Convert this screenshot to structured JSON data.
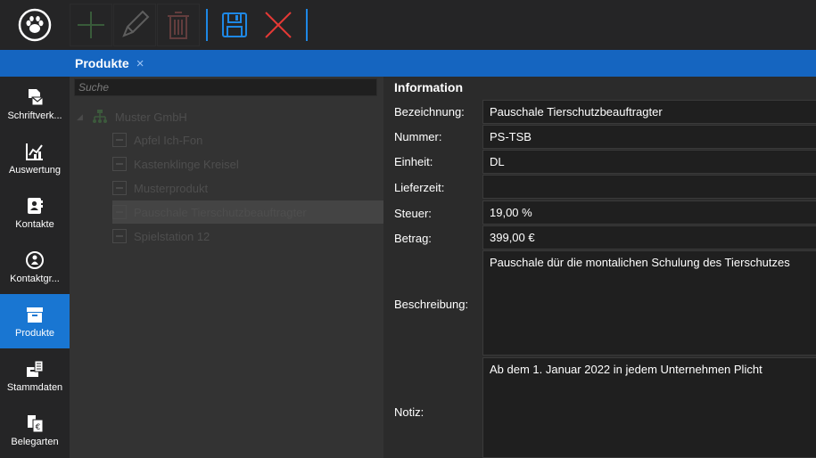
{
  "toolbar": {
    "buttons": [
      {
        "name": "add",
        "icon": "plus-icon"
      },
      {
        "name": "edit",
        "icon": "pencil-icon"
      },
      {
        "name": "delete",
        "icon": "trash-icon"
      },
      {
        "name": "save",
        "icon": "floppy-disk-icon"
      },
      {
        "name": "cancel",
        "icon": "x-icon"
      }
    ],
    "accent": "#1e88e5",
    "cancel_color": "#e53935"
  },
  "tab": {
    "label": "Produkte",
    "close": "×"
  },
  "sidebar": {
    "items": [
      {
        "label": "Schriftverk...",
        "icon": "letter-icon",
        "active": false
      },
      {
        "label": "Auswertung",
        "icon": "chart-icon",
        "active": false
      },
      {
        "label": "Kontakte",
        "icon": "contact-card-icon",
        "active": false
      },
      {
        "label": "Kontaktgr...",
        "icon": "contact-group-icon",
        "active": false
      },
      {
        "label": "Produkte",
        "icon": "product-box-icon",
        "active": true
      },
      {
        "label": "Stammdaten",
        "icon": "master-data-icon",
        "active": false
      },
      {
        "label": "Belegarten",
        "icon": "document-euro-icon",
        "active": false
      }
    ]
  },
  "search": {
    "placeholder": "Suche"
  },
  "tree": {
    "root": "Muster GmbH",
    "items": [
      {
        "label": "Apfel Ich-Fon",
        "selected": false
      },
      {
        "label": "Kastenklinge Kreisel",
        "selected": false
      },
      {
        "label": "Musterprodukt",
        "selected": false
      },
      {
        "label": "Pauschale Tierschutzbeauftragter",
        "selected": true
      },
      {
        "label": "Spielstation 12",
        "selected": false
      }
    ]
  },
  "info": {
    "header": "Information",
    "fields": [
      {
        "label": "Bezeichnung:",
        "value": "Pauschale Tierschutzbeauftragter"
      },
      {
        "label": "Nummer:",
        "value": "PS-TSB"
      },
      {
        "label": "Einheit:",
        "value": "DL"
      },
      {
        "label": "Lieferzeit:",
        "value": ""
      },
      {
        "label": "Steuer:",
        "value": "19,00 %"
      },
      {
        "label": "Betrag:",
        "value": "399,00 €"
      }
    ],
    "beschreibung": {
      "label": "Beschreibung:",
      "value": "Pauschale dür die montalichen Schulung des Tierschutzes"
    },
    "notiz": {
      "label": "Notiz:",
      "value": "Ab dem 1. Januar 2022 in jedem Unternehmen Plicht"
    }
  },
  "colors": {
    "tabstrip": "#1565c0",
    "sidebar_active": "#1976d2"
  }
}
